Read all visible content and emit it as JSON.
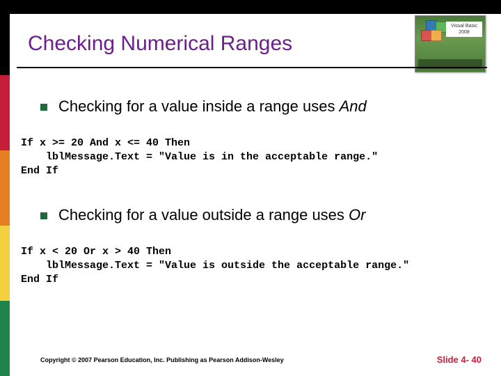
{
  "title": "Checking Numerical Ranges",
  "bullets": {
    "b1_pre": "Checking for a value inside a range uses ",
    "b1_ital": "And",
    "b2_pre": "Checking for a value outside a range uses ",
    "b2_ital": "Or"
  },
  "code": {
    "block1": "If x >= 20 And x <= 40 Then\n    lblMessage.Text = \"Value is in the acceptable range.\"\nEnd If",
    "block2": "If x < 20 Or x > 40 Then\n    lblMessage.Text = \"Value is outside the acceptable range.\"\nEnd If"
  },
  "footer": {
    "copyright": "Copyright © 2007 Pearson Education, Inc. Publishing as Pearson Addison-Wesley",
    "slide": "Slide 4- 40"
  },
  "cover": {
    "label": "Visual Basic 2008"
  }
}
